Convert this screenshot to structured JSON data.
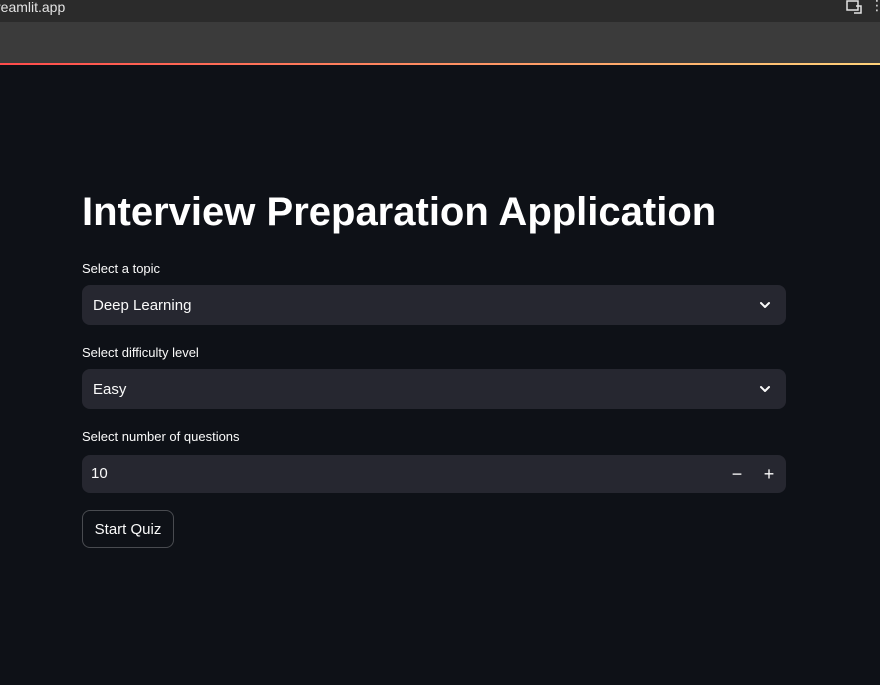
{
  "browser": {
    "url_fragment": "reamlit.app",
    "more_glyph": "⋮"
  },
  "page": {
    "title": "Interview Preparation Application"
  },
  "form": {
    "topic": {
      "label": "Select a topic",
      "value": "Deep Learning"
    },
    "difficulty": {
      "label": "Select difficulty level",
      "value": "Easy"
    },
    "questions": {
      "label": "Select number of questions",
      "value": "10",
      "minus": "−",
      "plus": "+"
    },
    "start_button": "Start Quiz"
  },
  "colors": {
    "background": "#0e1117",
    "widget": "#262730",
    "accent_start": "#ff4b4b",
    "accent_end": "#ffd27a"
  },
  "icons": [
    "chevron-down-icon",
    "share-icon",
    "more-vertical-icon"
  ]
}
